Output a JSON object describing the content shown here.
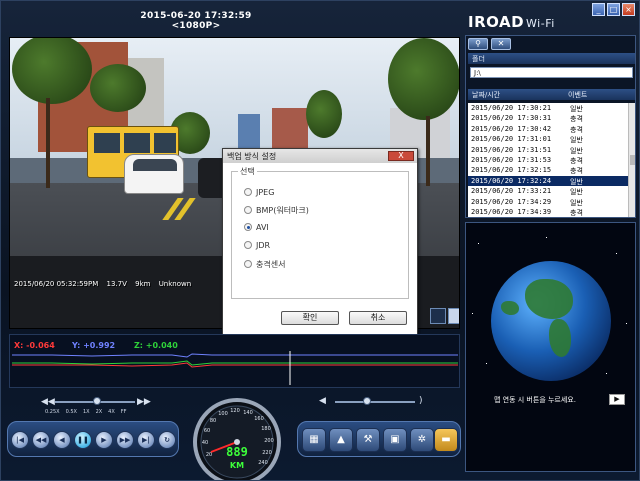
{
  "header": {
    "timestamp": "2015-06-20 17:32:59 <1080P>"
  },
  "brand": {
    "name": "IROAD",
    "suffix": "Wi-Fi"
  },
  "window_buttons": [
    "minimize",
    "maximize",
    "close"
  ],
  "video": {
    "osd_date": "2015/06/20 05:32:59PM",
    "osd_voltage": "13.7V",
    "osd_speed": "9km",
    "osd_gps": "Unknown"
  },
  "dialog": {
    "title": "백업 방식 설정",
    "close_label": "X",
    "group_label": "선택",
    "options": [
      {
        "label": "JPEG",
        "selected": false
      },
      {
        "label": "BMP(워터마크)",
        "selected": false
      },
      {
        "label": "AVI",
        "selected": true
      },
      {
        "label": "JDR",
        "selected": false
      },
      {
        "label": "충격센서",
        "selected": false
      }
    ],
    "ok_label": "확인",
    "cancel_label": "취소"
  },
  "gsensor": {
    "x_label": "X: -0.064",
    "y_label": "Y: +0.992",
    "z_label": "Z: +0.040",
    "colors": {
      "x": "#ff3a3a",
      "y": "#6f82ff",
      "z": "#2fd13a"
    }
  },
  "speed_control": {
    "prev_icon": "double-left-triangle-icon",
    "next_icon": "double-right-triangle-icon",
    "labels": [
      "0.25X",
      "0.5X",
      "1X",
      "2X",
      "4X",
      "FF"
    ]
  },
  "playback": {
    "buttons": [
      {
        "name": "first-icon",
        "glyph": "|◀"
      },
      {
        "name": "rewind-icon",
        "glyph": "◀◀"
      },
      {
        "name": "step-back-icon",
        "glyph": "◀"
      },
      {
        "name": "pause-icon",
        "glyph": "❚❚"
      },
      {
        "name": "play-icon",
        "glyph": "▶"
      },
      {
        "name": "fast-forward-icon",
        "glyph": "▶▶"
      },
      {
        "name": "last-icon",
        "glyph": "▶|"
      },
      {
        "name": "repeat-icon",
        "glyph": "↻"
      }
    ]
  },
  "speedometer": {
    "speed": "9",
    "speed_display": "889",
    "unit": "KM",
    "ticks": [
      "20",
      "40",
      "60",
      "80",
      "100",
      "120",
      "140",
      "160",
      "180",
      "200",
      "220",
      "240"
    ]
  },
  "tools": {
    "buttons": [
      {
        "name": "film-icon",
        "glyph": "▦"
      },
      {
        "name": "warning-icon",
        "glyph": "▲"
      },
      {
        "name": "settings-tools-icon",
        "glyph": "⚒"
      },
      {
        "name": "save-icon",
        "glyph": "▣"
      },
      {
        "name": "gear-icon",
        "glyph": "✲"
      },
      {
        "name": "folder-icon",
        "glyph": "▬"
      }
    ]
  },
  "right_panel": {
    "icons": [
      {
        "name": "search-icon",
        "glyph": "⚲"
      },
      {
        "name": "wrench-icon",
        "glyph": "✕"
      }
    ],
    "folder_label": "폴더",
    "folder_value": "J:\\",
    "col_datetime": "날짜/시간",
    "col_event": "이벤트",
    "rows": [
      {
        "datetime": "2015/06/20 17:30:21",
        "event": "일반",
        "selected": false
      },
      {
        "datetime": "2015/06/20 17:30:31",
        "event": "충격",
        "selected": false
      },
      {
        "datetime": "2015/06/20 17:30:42",
        "event": "충격",
        "selected": false
      },
      {
        "datetime": "2015/06/20 17:31:01",
        "event": "일반",
        "selected": false
      },
      {
        "datetime": "2015/06/20 17:31:51",
        "event": "일반",
        "selected": false
      },
      {
        "datetime": "2015/06/20 17:31:53",
        "event": "충격",
        "selected": false
      },
      {
        "datetime": "2015/06/20 17:32:15",
        "event": "충격",
        "selected": false
      },
      {
        "datetime": "2015/06/20 17:32:24",
        "event": "일반",
        "selected": true
      },
      {
        "datetime": "2015/06/20 17:33:21",
        "event": "일반",
        "selected": false
      },
      {
        "datetime": "2015/06/20 17:34:29",
        "event": "일반",
        "selected": false
      },
      {
        "datetime": "2015/06/20 17:34:39",
        "event": "충격",
        "selected": false
      }
    ]
  },
  "map_panel": {
    "message": "맵 연동 시 버튼을 누르세요.",
    "play_glyph": "▶"
  }
}
